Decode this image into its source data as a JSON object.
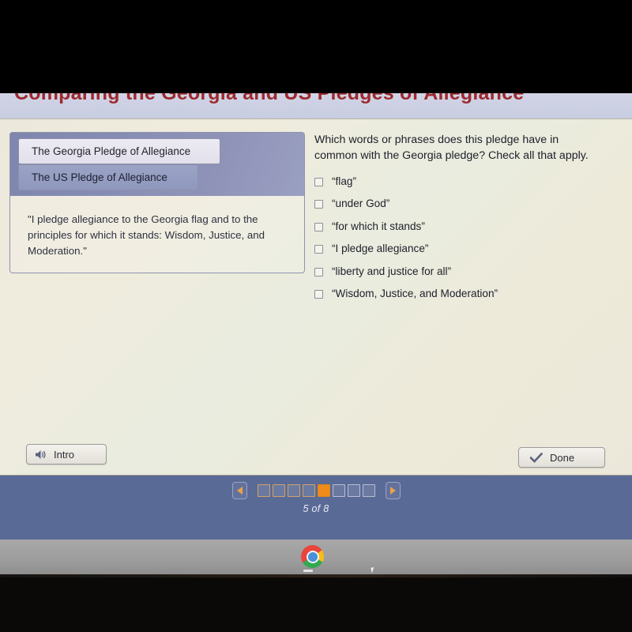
{
  "page_title": "Comparing the Georgia and US Pledges of Allegiance",
  "tabs": [
    {
      "label": "The Georgia Pledge of Allegiance",
      "selected": true
    },
    {
      "label": "The US Pledge of Allegiance",
      "selected": false
    }
  ],
  "pledge_text": "\"I pledge allegiance to the Georgia flag and to the principles for which it stands: Wisdom, Justice, and Moderation.\"",
  "question": {
    "prompt": "Which words or phrases does this pledge have in common with the Georgia pledge? Check all that apply.",
    "options": [
      {
        "label": "“flag”",
        "checked": false
      },
      {
        "label": "“under God”",
        "checked": false
      },
      {
        "label": "“for which it stands”",
        "checked": false
      },
      {
        "label": "“I pledge allegiance”",
        "checked": false
      },
      {
        "label": "“liberty and justice for all”",
        "checked": false
      },
      {
        "label": "“Wisdom, Justice, and Moderation”",
        "checked": false
      }
    ]
  },
  "footer": {
    "intro_label": "Intro",
    "intro_icon": "speaker-icon",
    "done_label": "Done",
    "done_icon": "checkmark-icon"
  },
  "pagination": {
    "prev_icon": "triangle-left-icon",
    "next_icon": "triangle-right-icon",
    "total_pages": 8,
    "current_page": 5,
    "counter_text": "5 of 8",
    "active_color": "#ef8b1b"
  },
  "taskbar": {
    "icons": [
      {
        "name": "chrome-icon"
      }
    ]
  },
  "colors": {
    "title": "#9c2a2e",
    "accent": "#ef8b1b",
    "desktop": "#5a6a96",
    "panel": "#ece8dc",
    "tab_selected": "#eceaf2",
    "tab_unselected": "#9ba3c6"
  }
}
